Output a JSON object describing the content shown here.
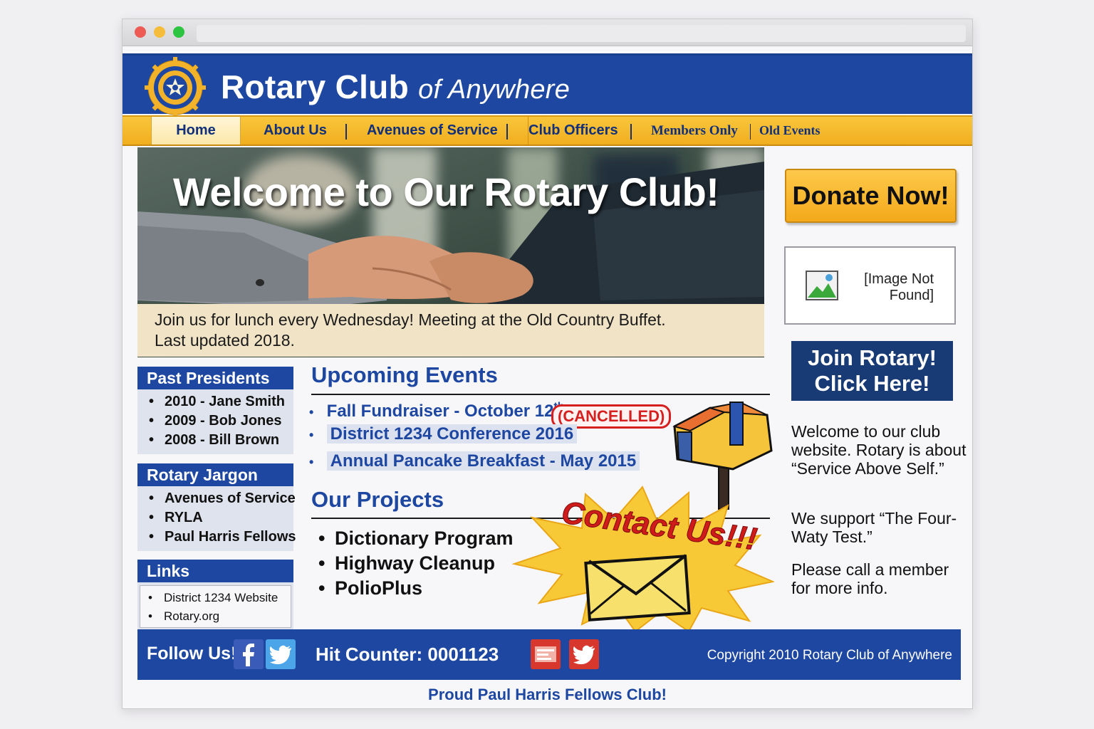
{
  "site": {
    "title_main": "Rotary Club",
    "title_of": "of Anywhere"
  },
  "nav": {
    "items": [
      "Home",
      "About Us",
      "Avenues of Service",
      "Club Officers",
      "Members Only",
      "Old Events"
    ]
  },
  "hero": {
    "title": "Welcome to Our Rotary Club!",
    "caption_line1": "Join us for lunch every Wednesday! Meeting at the Old Country Buffet.",
    "caption_line2": "Last updated 2018."
  },
  "past_presidents": {
    "heading": "Past Presidents",
    "items": [
      "2010 - Jane Smith",
      "2009 - Bob Jones",
      "2008 - Bill Brown"
    ]
  },
  "jargon": {
    "heading": "Rotary Jargon",
    "items": [
      "Avenues of Service",
      "RYLA",
      "Paul Harris Fellows"
    ]
  },
  "links": {
    "heading": "Links",
    "items": [
      "District 1234 Website",
      "Rotary.org"
    ]
  },
  "events": {
    "heading": "Upcoming Events",
    "items": [
      "Fall Fundraiser - October 12",
      "District 1234 Conference 2016",
      "Annual Pancake Breakfast -  May 2015"
    ],
    "first_superscript": "th",
    "cancelled_badge": "(CANCELLED)"
  },
  "projects": {
    "heading": "Our Projects",
    "items": [
      "Dictionary Program",
      "Highway Cleanup",
      "PolioPlus"
    ]
  },
  "contact": {
    "label": "Contact Us!!!"
  },
  "right": {
    "donate": "Donate Now!",
    "image_missing": "[Image Not Found]",
    "join_line1": "Join Rotary!",
    "join_line2": "Click Here!",
    "welcome_text": "Welcome to our club website. Rotary is about “Service Above Self.”",
    "support_text": "We support “The Four-Waty Test.”",
    "call_text": "Please call a member for more info."
  },
  "footer": {
    "follow": "Follow Us!",
    "counter": "Hit Counter: 0001123",
    "copyright": "Copyright 2010 Rotary Club of Anywhere",
    "proud": "Proud Paul Harris Fellows Club!"
  },
  "colors": {
    "brand_blue": "#1d47a0",
    "nav_gold": "#f0ae1e",
    "cancel_red": "#d62020",
    "caption_beige": "#f1e3c6"
  },
  "icons": {
    "logo": "rotary-wheel-icon",
    "mailbox": "mailbox-icon",
    "envelope": "envelope-icon",
    "broken_image": "broken-image-icon",
    "facebook": "facebook-icon",
    "twitter": "twitter-icon"
  }
}
